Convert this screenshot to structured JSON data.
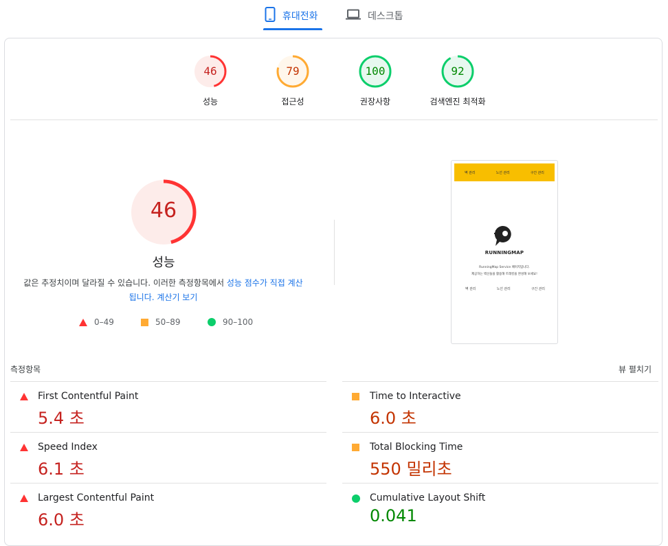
{
  "tabs": {
    "mobile": "휴대전화",
    "desktop": "데스크톱"
  },
  "gauges": [
    {
      "label": "성능",
      "score": "46",
      "value": 46,
      "color": "#ff3333",
      "text_color": "#c5221f",
      "bg": "#fdecea"
    },
    {
      "label": "접근성",
      "score": "79",
      "value": 79,
      "color": "#ffaa33",
      "text_color": "#c33300",
      "bg": "#fff7ec"
    },
    {
      "label": "권장사항",
      "score": "100",
      "value": 100,
      "color": "#0cce6b",
      "text_color": "#008800",
      "bg": "#e7f8ef"
    },
    {
      "label": "검색엔진 최적화",
      "score": "92",
      "value": 92,
      "color": "#0cce6b",
      "text_color": "#008800",
      "bg": "#e7f8ef"
    }
  ],
  "performance": {
    "score": "46",
    "value": 46,
    "title": "성능",
    "desc_plain": "값은 추정치이며 달라질 수 있습니다. 이러한 측정항목에서",
    "desc_link1": "성능 점수가 직접 계산됩니다.",
    "desc_link2": "계산기 보기"
  },
  "legend": [
    {
      "label": "0–49",
      "shape": "triangle",
      "color": "#ff3333"
    },
    {
      "label": "50–89",
      "shape": "square",
      "color": "#ffaa33"
    },
    {
      "label": "90–100",
      "shape": "circle",
      "color": "#0cce6b"
    }
  ],
  "metrics_section": {
    "title": "측정항목",
    "expand_label": "뷰 펼치기"
  },
  "metrics": [
    {
      "name": "First Contentful Paint",
      "value": "5.4 초",
      "status": "fail",
      "color": "#c5221f",
      "icon_color": "#ff3333"
    },
    {
      "name": "Time to Interactive",
      "value": "6.0 초",
      "status": "average",
      "color": "#c33300",
      "icon_color": "#ffaa33"
    },
    {
      "name": "Speed Index",
      "value": "6.1 초",
      "status": "fail",
      "color": "#c5221f",
      "icon_color": "#ff3333"
    },
    {
      "name": "Total Blocking Time",
      "value": "550 밀리초",
      "status": "average",
      "color": "#c33300",
      "icon_color": "#ffaa33"
    },
    {
      "name": "Largest Contentful Paint",
      "value": "6.0 초",
      "status": "fail",
      "color": "#c5221f",
      "icon_color": "#ff3333"
    },
    {
      "name": "Cumulative Layout Shift",
      "value": "0.041",
      "status": "pass",
      "color": "#008800",
      "icon_color": "#0cce6b"
    }
  ],
  "preview": {
    "nav": [
      "벽 관리",
      "노선 관리",
      "구간 관리"
    ],
    "brand": "RUNNINGMAP",
    "line1": "RunningMap Service 페이지입니다.",
    "line2": "제공하는 벽선들을 활용해 트레킹을 완성해 보세요!",
    "links": [
      "벽 관리",
      "노선 관리",
      "구간 관리"
    ],
    "nav_color": "#f8be00"
  }
}
